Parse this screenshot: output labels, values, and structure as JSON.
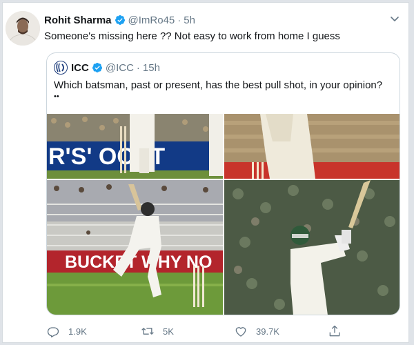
{
  "tweet": {
    "author_name": "Rohit Sharma",
    "author_handle": "@ImRo45",
    "separator": "·",
    "time": "5h",
    "text": "Someone's missing here ?? Not easy to work from home I guess",
    "verified": true
  },
  "quoted_tweet": {
    "author_name": "ICC",
    "author_handle": "@ICC",
    "separator": "·",
    "time": "15h",
    "text": "Which batsman, past or present, has the best pull shot, in your opinion?",
    "extra": "••",
    "verified": true,
    "media": [
      {
        "id": "photo-1",
        "banner_text": "R'S' OOST"
      },
      {
        "id": "photo-2",
        "banner_text": ""
      },
      {
        "id": "photo-3",
        "banner_text": "BUCKET WHY NO"
      },
      {
        "id": "photo-4",
        "banner_text": ""
      }
    ]
  },
  "actions": {
    "reply_count": "1.9K",
    "retweet_count": "5K",
    "like_count": "39.7K"
  },
  "colors": {
    "verified_blue": "#1da1f2",
    "muted_text": "#657786",
    "border": "#ccd6dd"
  },
  "icons": [
    "verified-icon",
    "caret-down-icon",
    "icc-logo-icon",
    "reply-icon",
    "retweet-icon",
    "like-icon",
    "share-icon"
  ]
}
